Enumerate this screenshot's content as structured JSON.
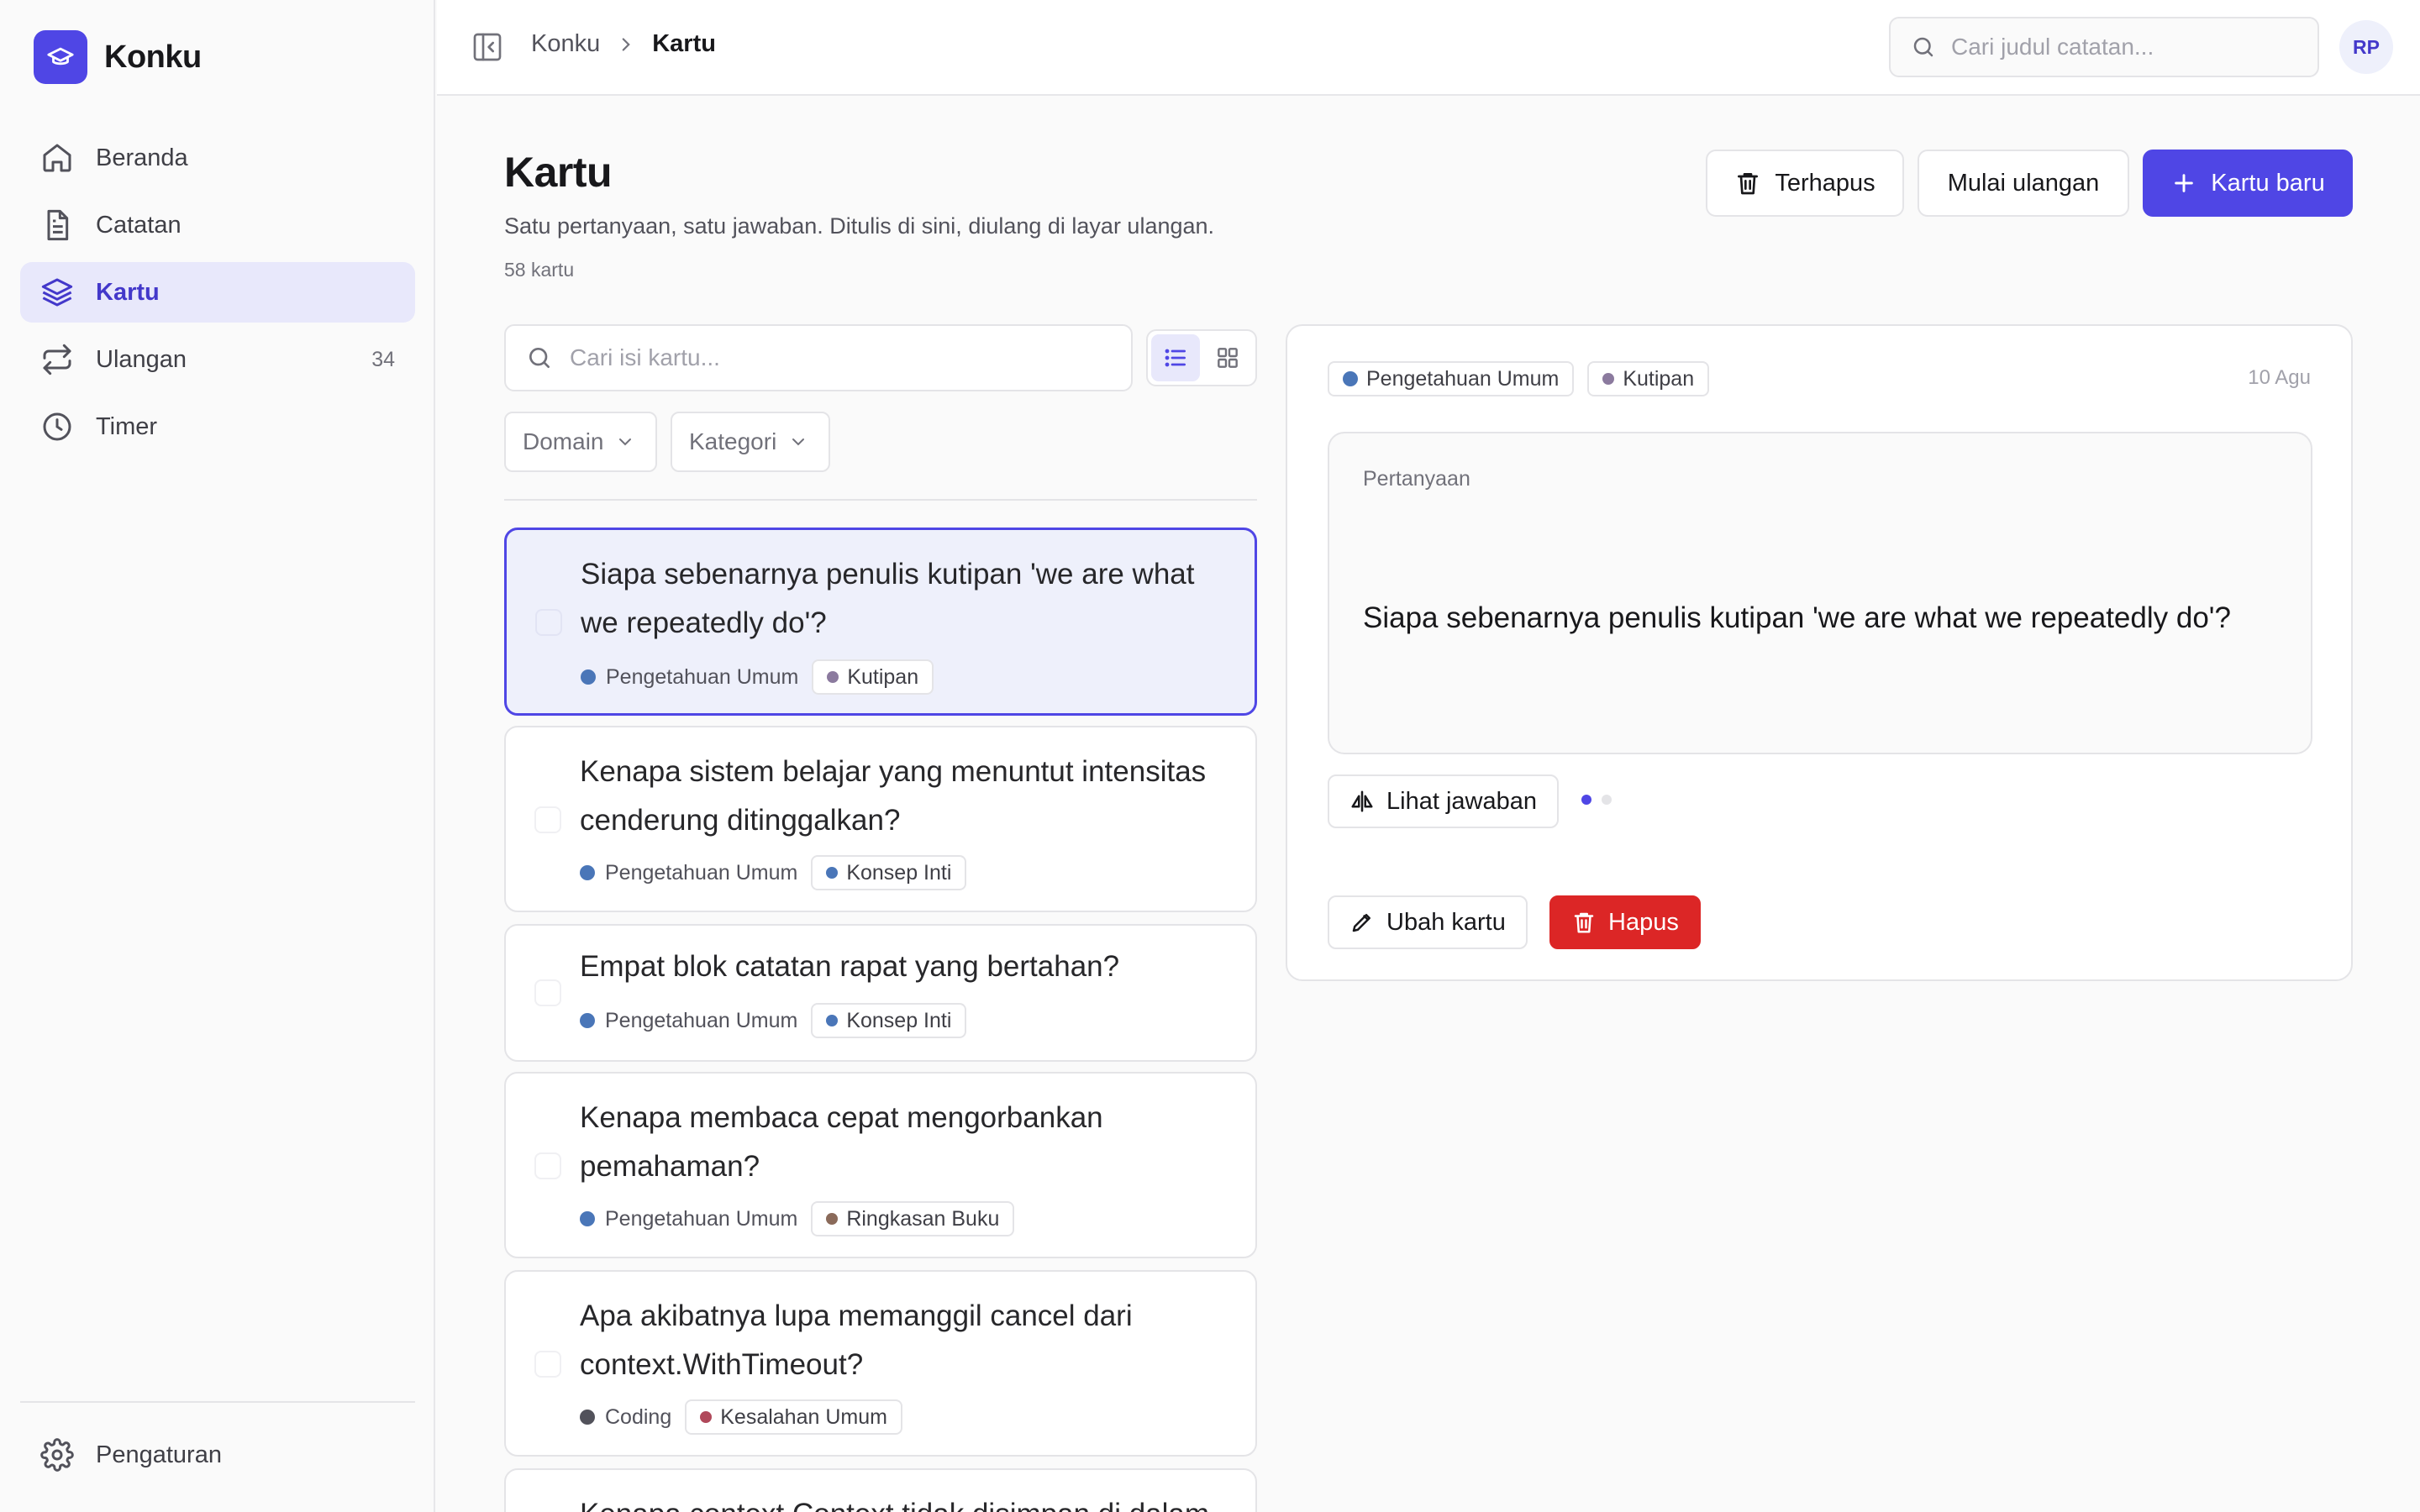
{
  "app": {
    "name": "Konku"
  },
  "sidebar": {
    "items": [
      {
        "label": "Beranda",
        "icon": "home-icon"
      },
      {
        "label": "Catatan",
        "icon": "document-icon"
      },
      {
        "label": "Kartu",
        "icon": "layers-icon",
        "active": true
      },
      {
        "label": "Ulangan",
        "icon": "repeat-icon",
        "count": "34"
      },
      {
        "label": "Timer",
        "icon": "clock-icon"
      }
    ],
    "settings": {
      "label": "Pengaturan",
      "icon": "gear-icon"
    }
  },
  "topbar": {
    "breadcrumb": {
      "root": "Konku",
      "current": "Kartu"
    },
    "search_placeholder": "Cari judul catatan...",
    "avatar_initials": "RP"
  },
  "page": {
    "title": "Kartu",
    "subtitle": "Satu pertanyaan, satu jawaban. Ditulis di sini, diulang di layar ulangan.",
    "count": "58 kartu"
  },
  "actions": {
    "deleted_label": "Terhapus",
    "start_review_label": "Mulai ulangan",
    "new_card_label": "Kartu baru"
  },
  "list": {
    "search_placeholder": "Cari isi kartu...",
    "filters": {
      "domain": "Domain",
      "category": "Kategori"
    },
    "cards": [
      {
        "question": "Siapa sebenarnya penulis kutipan 'we are what we repeatedly do'?",
        "domain": "Pengetahuan Umum",
        "domain_color": "#4a76b8",
        "tag": "Kutipan",
        "tag_color": "#8b7a9e",
        "selected": true
      },
      {
        "question": "Kenapa sistem belajar yang menuntut intensitas cenderung ditinggalkan?",
        "domain": "Pengetahuan Umum",
        "domain_color": "#4a76b8",
        "tag": "Konsep Inti",
        "tag_color": "#4a76b8"
      },
      {
        "question": "Empat blok catatan rapat yang bertahan?",
        "domain": "Pengetahuan Umum",
        "domain_color": "#4a76b8",
        "tag": "Konsep Inti",
        "tag_color": "#4a76b8"
      },
      {
        "question": "Kenapa membaca cepat mengorbankan pemahaman?",
        "domain": "Pengetahuan Umum",
        "domain_color": "#4a76b8",
        "tag": "Ringkasan Buku",
        "tag_color": "#8a6a5a"
      },
      {
        "question": "Apa akibatnya lupa memanggil cancel dari context.WithTimeout?",
        "domain": "Coding",
        "domain_color": "#52525b",
        "tag": "Kesalahan Umum",
        "tag_color": "#b0485a"
      },
      {
        "question": "Kenapa context.Context tidak disimpan di dalam"
      }
    ]
  },
  "detail": {
    "domain": "Pengetahuan Umum",
    "tag": "Kutipan",
    "date": "10 Agu",
    "question_label": "Pertanyaan",
    "question": "Siapa sebenarnya penulis kutipan 'we are what we repeatedly do'?",
    "show_answer_label": "Lihat jawaban",
    "edit_label": "Ubah kartu",
    "delete_label": "Hapus"
  },
  "colors": {
    "accent": "#4f46e5",
    "danger": "#dc2626",
    "active_bg": "#e8e8fb"
  }
}
